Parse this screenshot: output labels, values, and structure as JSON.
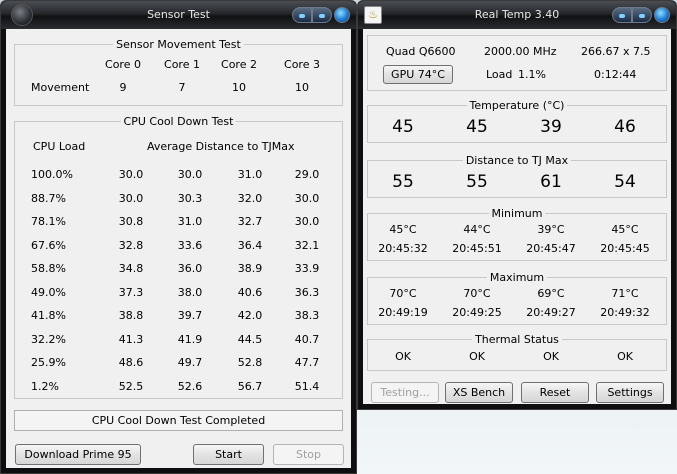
{
  "sensor_test": {
    "title": "Sensor Test",
    "movement": {
      "legend": "Sensor Movement Test",
      "cores": [
        "Core 0",
        "Core 1",
        "Core 2",
        "Core 3"
      ],
      "row_label": "Movement",
      "values": [
        "9",
        "7",
        "10",
        "10"
      ]
    },
    "cooldown": {
      "legend": "CPU Cool Down Test",
      "load_header": "CPU Load",
      "distance_header": "Average Distance to TJMax",
      "rows": [
        {
          "load": "100.0%",
          "values": [
            "30.0",
            "30.0",
            "31.0",
            "29.0"
          ]
        },
        {
          "load": "88.7%",
          "values": [
            "30.0",
            "30.3",
            "32.0",
            "30.0"
          ]
        },
        {
          "load": "78.1%",
          "values": [
            "30.8",
            "31.0",
            "32.7",
            "30.0"
          ]
        },
        {
          "load": "67.6%",
          "values": [
            "32.8",
            "33.6",
            "36.4",
            "32.1"
          ]
        },
        {
          "load": "58.8%",
          "values": [
            "34.8",
            "36.0",
            "38.9",
            "33.9"
          ]
        },
        {
          "load": "49.0%",
          "values": [
            "37.3",
            "38.0",
            "40.6",
            "36.3"
          ]
        },
        {
          "load": "41.8%",
          "values": [
            "38.8",
            "39.7",
            "42.0",
            "38.3"
          ]
        },
        {
          "load": "32.2%",
          "values": [
            "41.3",
            "41.9",
            "44.5",
            "40.7"
          ]
        },
        {
          "load": "25.9%",
          "values": [
            "48.6",
            "49.7",
            "52.8",
            "47.7"
          ]
        },
        {
          "load": "1.2%",
          "values": [
            "52.5",
            "52.6",
            "56.7",
            "51.4"
          ]
        }
      ]
    },
    "status": "CPU Cool Down Test Completed",
    "buttons": {
      "download": "Download Prime 95",
      "start": "Start",
      "stop": "Stop"
    }
  },
  "real_temp": {
    "title": "Real Temp 3.40",
    "cpu_name": "Quad Q6600",
    "clock": "2000.00 MHz",
    "multiplier": "266.67 x 7.5",
    "gpu_button": "GPU  74°C",
    "load_label": "Load",
    "load_value": "1.1%",
    "uptime": "0:12:44",
    "temperature": {
      "legend": "Temperature (°C)",
      "values": [
        "45",
        "45",
        "39",
        "46"
      ]
    },
    "distance": {
      "legend": "Distance to TJ Max",
      "values": [
        "55",
        "55",
        "61",
        "54"
      ]
    },
    "minimum": {
      "legend": "Minimum",
      "temps": [
        "45°C",
        "44°C",
        "39°C",
        "45°C"
      ],
      "times": [
        "20:45:32",
        "20:45:51",
        "20:45:47",
        "20:45:45"
      ]
    },
    "maximum": {
      "legend": "Maximum",
      "temps": [
        "70°C",
        "70°C",
        "69°C",
        "71°C"
      ],
      "times": [
        "20:49:19",
        "20:49:25",
        "20:49:27",
        "20:49:32"
      ]
    },
    "thermal": {
      "legend": "Thermal Status",
      "values": [
        "OK",
        "OK",
        "OK",
        "OK"
      ]
    },
    "buttons": {
      "testing": "Testing...",
      "xs_bench": "XS Bench",
      "reset": "Reset",
      "settings": "Settings"
    }
  }
}
